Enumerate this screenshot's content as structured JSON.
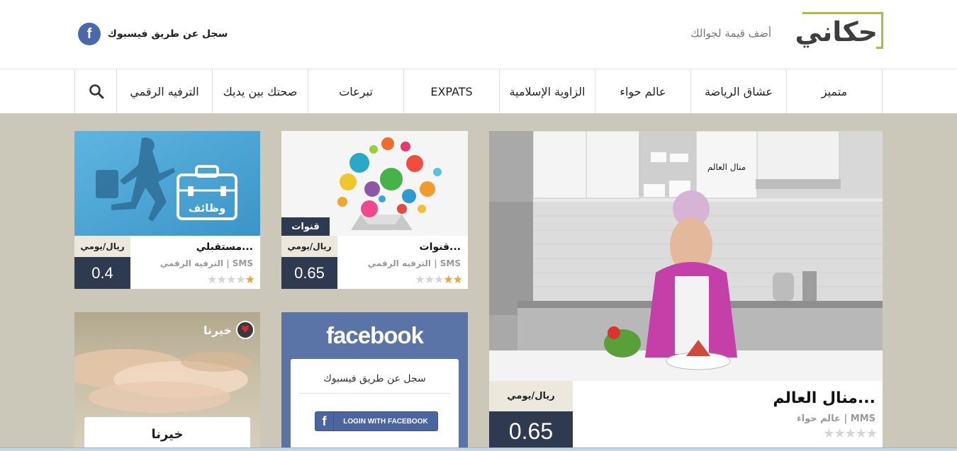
{
  "header": {
    "logo_text": "حكاني",
    "tagline": "أضف قيمة لجوالك",
    "facebook_login": "سجل عن طريق فيسبوك",
    "facebook_icon_letter": "f"
  },
  "nav": {
    "items": [
      "متميز",
      "عشاق الرياضة",
      "عالم حواء",
      "الزاوية الإسلامية",
      "EXPATS",
      "تبرعات",
      "صحتك بين يديك",
      "الترفيه الرقمي"
    ],
    "search_icon": "search-icon"
  },
  "featured": {
    "title": "منال العالم...",
    "subtitle": "عالم حواء | MMS",
    "price_unit": "ريال/يومي",
    "price": "0.65",
    "rating": 0,
    "image_text": "منال العالم"
  },
  "card_qanawat": {
    "badge": "قنوات",
    "title": "قنوات...",
    "subtitle": "الترفيه الرقمي | SMS",
    "price_unit": "ريال/يومي",
    "price": "0.65",
    "rating": 2
  },
  "card_jobs": {
    "image_text": "وظائف",
    "title": "مستقبلي...",
    "subtitle": "الترفيه الرقمي | SMS",
    "price_unit": "ريال/يومي",
    "price": "0.4",
    "rating": 1
  },
  "facebook_panel": {
    "brand": "facebook",
    "label": "سجل عن طريق فيسبوك",
    "button": "LOGIN WITH FACEBOOK",
    "button_icon": "f"
  },
  "khairna": {
    "brand": "خيرنا",
    "title": "خيرنا"
  },
  "colors": {
    "accent_green": "#a6c13c",
    "navy": "#2d3a50",
    "facebook_blue": "#5b74a8",
    "background": "#cbc7b9",
    "star_on": "#f2a23c"
  }
}
